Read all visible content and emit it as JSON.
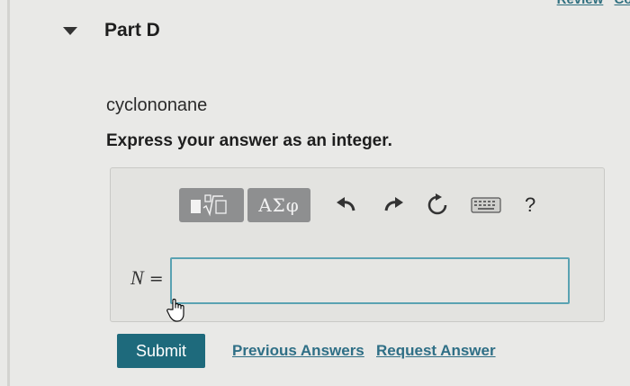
{
  "top_nav": {
    "links": [
      "Review",
      "Cons"
    ]
  },
  "part": {
    "title": "Part D"
  },
  "question": {
    "text": "cyclononane",
    "instructions": "Express your answer as an integer."
  },
  "toolbar": {
    "symbols_label": "ΑΣφ",
    "templates_icon": "templates-icon",
    "undo_icon": "undo-icon",
    "redo_icon": "redo-icon",
    "reset_icon": "reset-icon",
    "keyboard_icon": "keyboard-icon",
    "help_label": "?"
  },
  "answer": {
    "variable": "N",
    "equals": " =",
    "value": ""
  },
  "actions": {
    "submit_label": "Submit",
    "previous_answers_label": "Previous Answers",
    "request_answer_label": "Request Answer"
  },
  "colors": {
    "accent": "#1e6a7c",
    "link": "#2f6f86",
    "input_border": "#5aa2b2",
    "tool_button": "#8e8f90"
  }
}
